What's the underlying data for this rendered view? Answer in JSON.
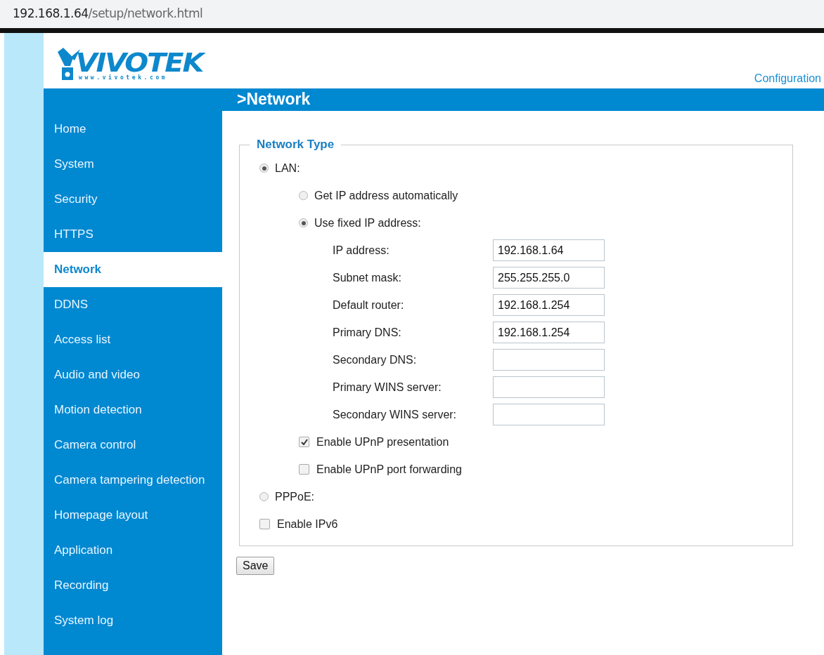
{
  "address_bar": {
    "host": "192.168.1.64",
    "path": "/setup/network.html"
  },
  "logo": {
    "name": "VIVOTEK",
    "url": "www.vivotek.com"
  },
  "header_link": "Configuration",
  "page_title": ">Network",
  "sidebar": {
    "items": [
      {
        "label": "Home",
        "selected": false
      },
      {
        "label": "System",
        "selected": false
      },
      {
        "label": "Security",
        "selected": false
      },
      {
        "label": "HTTPS",
        "selected": false
      },
      {
        "label": "Network",
        "selected": true
      },
      {
        "label": "DDNS",
        "selected": false
      },
      {
        "label": "Access list",
        "selected": false
      },
      {
        "label": "Audio and video",
        "selected": false
      },
      {
        "label": "Motion detection",
        "selected": false
      },
      {
        "label": "Camera control",
        "selected": false
      },
      {
        "label": "Camera tampering detection",
        "selected": false
      },
      {
        "label": "Homepage layout",
        "selected": false
      },
      {
        "label": "Application",
        "selected": false
      },
      {
        "label": "Recording",
        "selected": false
      },
      {
        "label": "System log",
        "selected": false
      }
    ]
  },
  "network_type": {
    "legend": "Network Type",
    "options": [
      {
        "kind": "radio",
        "label": "LAN:",
        "selected": true,
        "children": [
          {
            "kind": "radio",
            "label": "Get IP address automatically",
            "selected": false
          },
          {
            "kind": "radio",
            "label": "Use fixed IP address:",
            "selected": true,
            "children": [
              {
                "kind": "field",
                "label": "IP address:",
                "value": "192.168.1.64"
              },
              {
                "kind": "field",
                "label": "Subnet mask:",
                "value": "255.255.255.0"
              },
              {
                "kind": "field",
                "label": "Default router:",
                "value": "192.168.1.254"
              },
              {
                "kind": "field",
                "label": "Primary DNS:",
                "value": "192.168.1.254"
              },
              {
                "kind": "field",
                "label": "Secondary DNS:"
              },
              {
                "kind": "field",
                "label": "Primary WINS server:"
              },
              {
                "kind": "field",
                "label": "Secondary WINS server:"
              }
            ]
          },
          {
            "kind": "checkbox",
            "label": "Enable UPnP presentation",
            "checked": true
          },
          {
            "kind": "checkbox",
            "label": "Enable UPnP port forwarding",
            "checked": false
          }
        ]
      },
      {
        "kind": "radio",
        "label": "PPPoE:",
        "selected": false
      },
      {
        "kind": "checkbox",
        "label": "Enable IPv6",
        "checked": false
      }
    ]
  },
  "save_button": "Save"
}
